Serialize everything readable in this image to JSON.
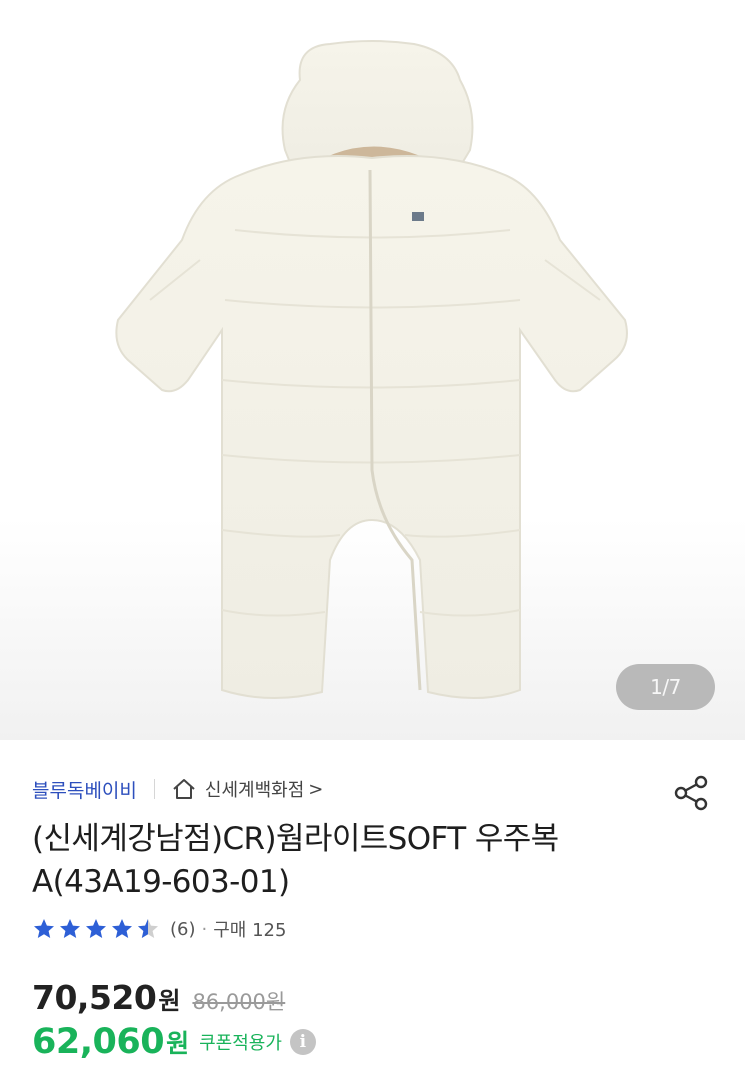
{
  "gallery": {
    "page_indicator": "1/7",
    "image_alt": "아이보리 패딩 우주복"
  },
  "product": {
    "brand": "블루독베이비",
    "store": "신세계백화점",
    "store_chevron": ">",
    "title": "(신세계강남점)CR)웜라이트SOFT 우주복A(43A19-603-01)",
    "rating": 4.5,
    "review_count": "(6)",
    "separator": "·",
    "purchase_count": "구매 125",
    "price": "70,520",
    "currency": "원",
    "original_price": "86,000원",
    "coupon_price": "62,060",
    "coupon_currency": "원",
    "coupon_label": "쿠폰적용가",
    "info_glyph": "i"
  },
  "colors": {
    "brand": "#2d4fbd",
    "star": "#2d5fd6",
    "coupon": "#19b35a"
  },
  "icons": {
    "store": "home-icon",
    "share": "share-icon",
    "info": "info-icon"
  }
}
